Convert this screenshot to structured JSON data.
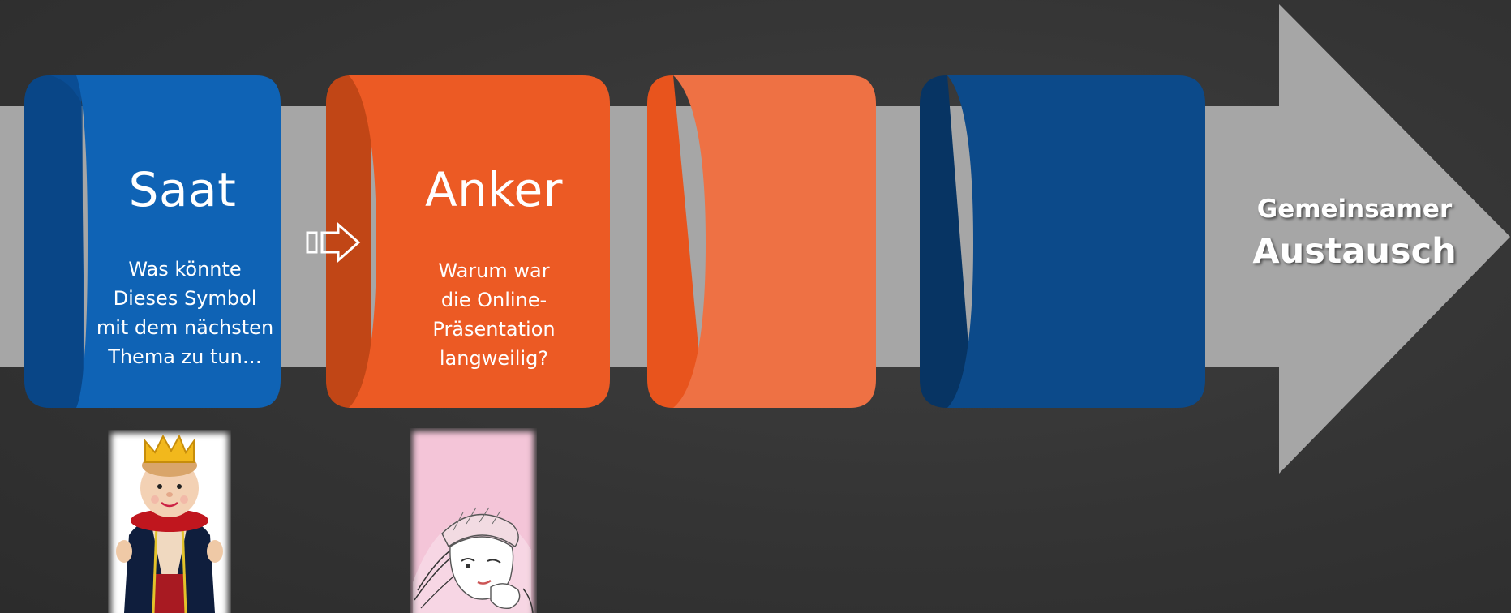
{
  "stages": [
    {
      "title": "Saat",
      "description_lines": [
        "Was könnte",
        "Dieses Symbol",
        "mit dem nächsten",
        "Thema zu tun…"
      ],
      "image": "king-puppet",
      "color": "#0f63b5"
    },
    {
      "title": "Anker",
      "description_lines": [
        "Warum war",
        "die Online-",
        "Präsentation",
        "langweilig?"
      ],
      "image": "bored-girl",
      "color": "#ec5a24"
    },
    {
      "title": "",
      "description_lines": [],
      "color": "#ee7144"
    },
    {
      "title": "",
      "description_lines": [],
      "color": "#0c4a8a"
    }
  ],
  "connector_icon": "right-arrow-outline-icon",
  "arrow": {
    "line1": "Gemeinsamer",
    "line2": "Austausch",
    "color": "#a6a6a6"
  }
}
